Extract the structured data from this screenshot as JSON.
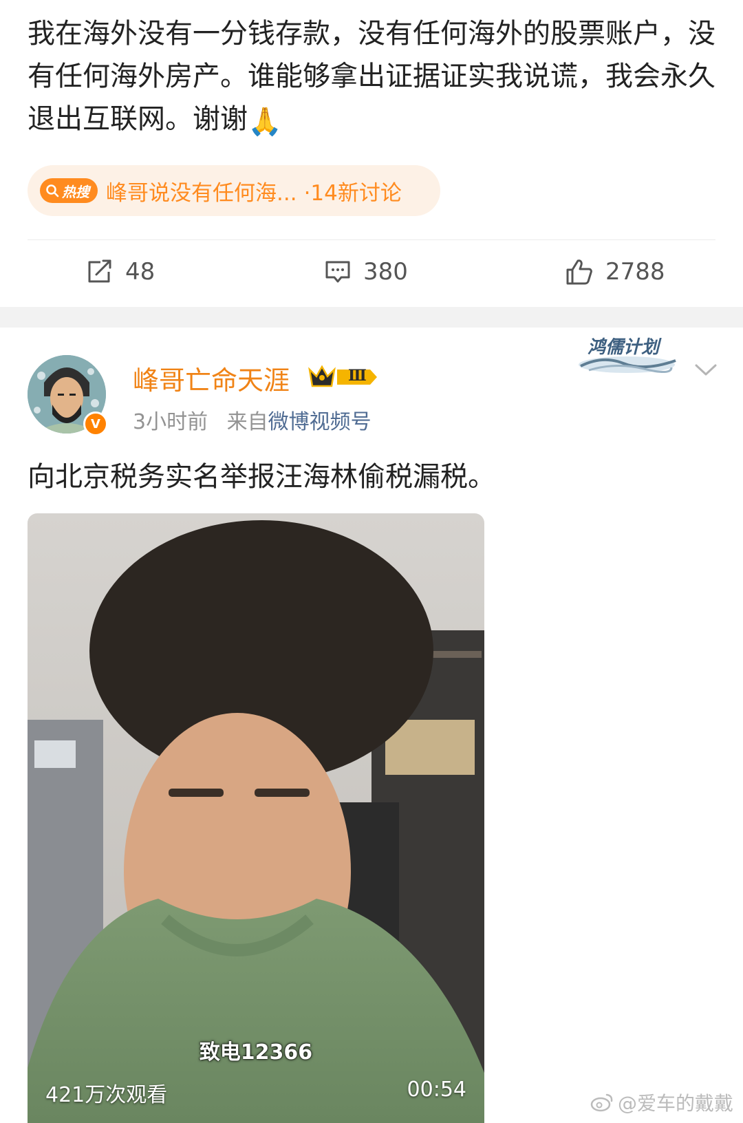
{
  "post1": {
    "text": "我在海外没有一分钱存款，没有任何海外的股票账户，没有任何海外房产。谁能够拿出证据证实我说谎，我会永久退出互联网。谢谢",
    "emoji": "🙏",
    "hot_search": {
      "badge": "热搜",
      "text": "峰哥说没有任何海...",
      "count": "·14新讨论"
    },
    "actions": {
      "repost_count": "48",
      "comment_count": "380",
      "like_count": "2788"
    }
  },
  "post2": {
    "campaign_badge": "鸿儒计划",
    "author": {
      "name": "峰哥亡命天涯",
      "vip_level": "Ⅲ",
      "verified_mark": "V"
    },
    "meta": {
      "time": "3小时前",
      "source_prefix": "来自",
      "source": "微博视频号"
    },
    "text": "向北京税务实名举报汪海林偷税漏税。",
    "video": {
      "subtitle": "致电12366",
      "views": "421万次观看",
      "duration": "00:54"
    }
  },
  "watermark": "@爱车的戴戴",
  "colors": {
    "orange": "#f08316",
    "hot_orange": "#ff8b1f",
    "link_blue": "#506c93",
    "gray_text": "#939393"
  },
  "icons": {
    "repost": "repost-icon",
    "comment": "comment-icon",
    "like": "thumbs-up-icon",
    "more": "chevron-down-icon",
    "search": "search-icon",
    "weibo": "weibo-logo-icon"
  }
}
